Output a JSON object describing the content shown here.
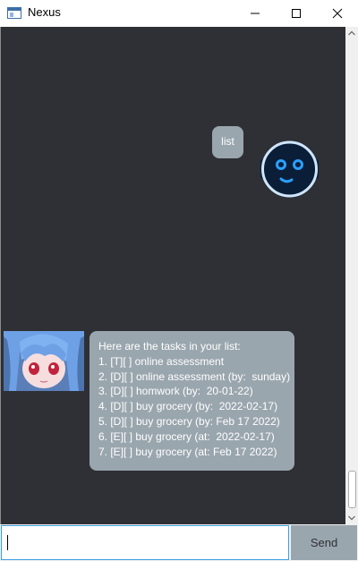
{
  "window": {
    "title": "Nexus"
  },
  "chat": {
    "user_message": "list",
    "bot_message": {
      "lines": [
        "Here are the tasks in your list:",
        "1. [T][ ] online assessment",
        "2. [D][ ] online assessment (by:  sunday)",
        "3. [D][ ] homwork (by:  20-01-22)",
        "4. [D][ ] buy grocery (by:  2022-02-17)",
        "5. [D][ ] buy grocery (by: Feb 17 2022)",
        "6. [E][ ] buy grocery (at:  2022-02-17)",
        "7. [E][ ] buy grocery (at: Feb 17 2022)"
      ]
    }
  },
  "input": {
    "value": "",
    "send_label": "Send"
  },
  "icons": {
    "app": "window-app-icon",
    "minimize": "minimize-icon",
    "maximize": "maximize-icon",
    "close": "close-icon",
    "user_avatar": "robot-avatar-icon",
    "bot_avatar": "anime-girl-avatar"
  },
  "colors": {
    "chat_background": "#2e3035",
    "bubble": "#9aa6ae",
    "input_focus": "#3aa0e0"
  }
}
